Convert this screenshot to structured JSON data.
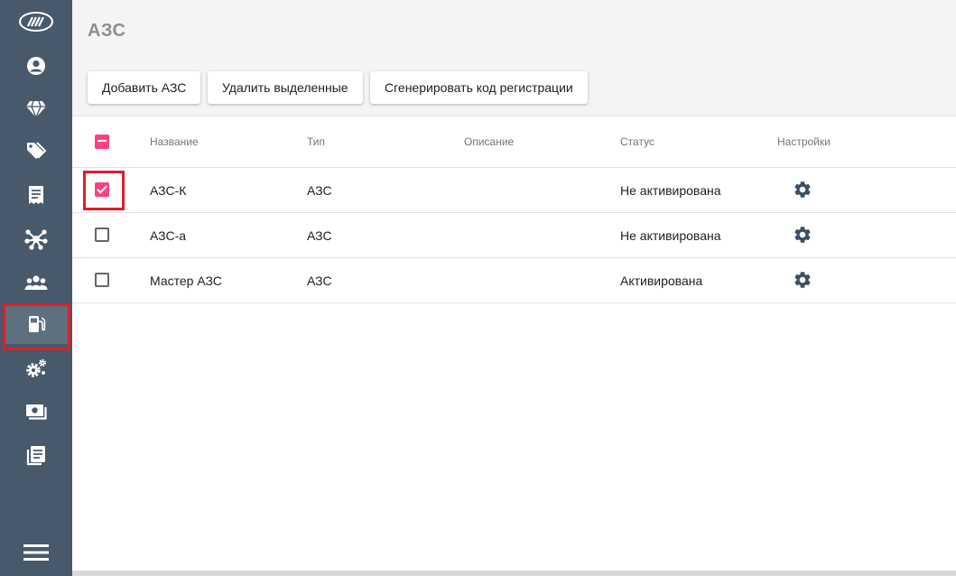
{
  "page": {
    "title": "АЗС"
  },
  "toolbar": {
    "add_label": "Добавить АЗС",
    "delete_label": "Удалить выделенные",
    "generate_label": "Сгенерировать код регистрации"
  },
  "table": {
    "columns": {
      "name": "Название",
      "type": "Тип",
      "description": "Описание",
      "status": "Статус",
      "settings": "Настройки"
    },
    "header_checkbox": "indeterminate",
    "rows": [
      {
        "name": "АЗС-К",
        "type": "АЗС",
        "description": "",
        "status": "Не активирована",
        "checked": true
      },
      {
        "name": "АЗС-а",
        "type": "АЗС",
        "description": "",
        "status": "Не активирована",
        "checked": false
      },
      {
        "name": "Мастер АЗС",
        "type": "АЗС",
        "description": "",
        "status": "Активирована",
        "checked": false
      }
    ]
  },
  "sidebar": {
    "items": [
      {
        "icon": "logo-icon"
      },
      {
        "icon": "user-circle-icon"
      },
      {
        "icon": "diamond-icon"
      },
      {
        "icon": "tags-icon"
      },
      {
        "icon": "receipt-icon"
      },
      {
        "icon": "network-icon"
      },
      {
        "icon": "users-icon"
      },
      {
        "icon": "gas-pump-icon",
        "active": true
      },
      {
        "icon": "cogs-icon"
      },
      {
        "icon": "money-icon"
      },
      {
        "icon": "book-icon"
      },
      {
        "icon": "menu-icon"
      }
    ]
  },
  "colors": {
    "sidebar_bg": "#47596a",
    "accent_pink": "#ff4081",
    "highlight_red": "#e21d25",
    "gear": "#3d4f60"
  }
}
